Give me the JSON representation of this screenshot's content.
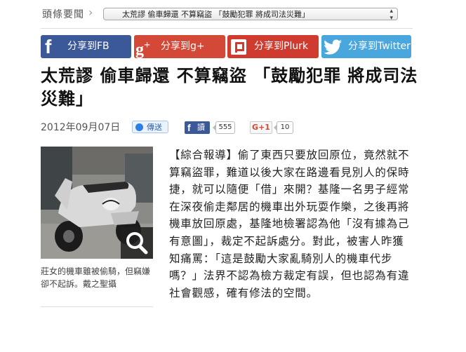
{
  "headline_nav": {
    "label": "頭條要聞",
    "selected": "太荒謬 偷車歸還 不算竊盜 「鼓勵犯罪 將成司法災難」"
  },
  "share": {
    "fb": "分享到FB",
    "gplus": "分享到g+",
    "plurk": "分享到Plurk",
    "twitter": "分享到Twitter"
  },
  "article": {
    "title": "太荒謬 偷車歸還 不算竊盜 「鼓勵犯罪 將成司法災難」",
    "date": "2012年09月07日",
    "send_label": "傳送",
    "fb_read": "讀",
    "fb_count": "555",
    "gplus_label": "G+1",
    "gplus_count": "10",
    "caption": "莊女的機車雖被偷騎，但竊嫌卻不起訴。戴之聖攝",
    "body": "【綜合報導】偷了東西只要放回原位，竟然就不算竊盜罪，難道以後大家在路邊看見別人的保時捷，就可以隨便「借」來開？基隆一名男子經常在深夜偷走鄰居的機車出外玩耍作樂，之後再將機車放回原處，基隆地檢署認為他「沒有據為己有意圖」，裁定不起訴處分。對此，被害人昨獲知痛罵：「這是鼓勵大家亂騎別人的機車代步嗎？」法界不認為檢方裁定有誤，但也認為有違社會觀感，確有修法的空間。"
  },
  "colors": {
    "facebook": "#3b5998",
    "googleplus": "#d34836",
    "plurk": "#cf3b2f",
    "twitter": "#4aa7de"
  }
}
